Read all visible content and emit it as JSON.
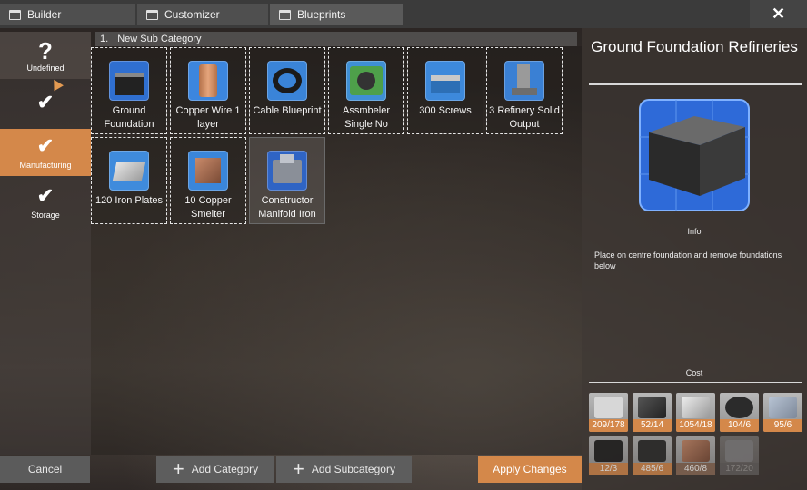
{
  "tabs": [
    {
      "label": "Builder",
      "icon": "window-icon"
    },
    {
      "label": "Customizer",
      "icon": "window-icon"
    },
    {
      "label": "Blueprints",
      "icon": "window-icon",
      "active": true
    }
  ],
  "close_glyph": "✕",
  "sidebar": {
    "items": [
      {
        "label": "Undefined",
        "glyph": "?"
      },
      {
        "label": "",
        "glyph": "✔"
      },
      {
        "label": "Manufacturing",
        "glyph": "✔",
        "selected": true
      },
      {
        "label": "Storage",
        "glyph": "✔"
      }
    ]
  },
  "subcategory": {
    "index": "1.",
    "name": "New Sub Category"
  },
  "blueprints": [
    {
      "label": "Ground Foundation",
      "icon": "foundation-icon",
      "color": "#2f6fd0"
    },
    {
      "label": "Copper Wire 1 layer",
      "icon": "copper-wire-spool-icon",
      "color": "#3c86de"
    },
    {
      "label": "Cable Blueprint",
      "icon": "cable-coil-icon",
      "color": "#3a84d8"
    },
    {
      "label": "Assmbeler Single No",
      "icon": "assembler-icon",
      "color": "#3f8fd4"
    },
    {
      "label": "300 Screws",
      "icon": "screws-icon",
      "color": "#3d89db"
    },
    {
      "label": "3 Refinery Solid Output",
      "icon": "refinery-icon",
      "color": "#3a80d4"
    },
    {
      "label": "120 Iron Plates",
      "icon": "iron-plate-icon",
      "color": "#3f8bdc"
    },
    {
      "label": "10 Copper Smelter",
      "icon": "smelter-icon",
      "color": "#3a86da"
    },
    {
      "label": "Constructor Manifold Iron",
      "icon": "constructor-icon",
      "color": "#2f64c4"
    }
  ],
  "detail": {
    "title": "Ground Foundation Refineries",
    "info_label": "Info",
    "info_text": "Place on centre foundation and remove foundations below",
    "cost_label": "Cost",
    "costs": [
      {
        "amount": "209/178",
        "icon": "concrete-icon"
      },
      {
        "amount": "52/14",
        "icon": "steel-beam-icon"
      },
      {
        "amount": "1054/18",
        "icon": "iron-plate-icon"
      },
      {
        "amount": "104/6",
        "icon": "motor-icon"
      },
      {
        "amount": "95/6",
        "icon": "metal-sheet-icon"
      },
      {
        "amount": "12/3",
        "icon": "computer-icon"
      },
      {
        "amount": "485/6",
        "icon": "frame-icon"
      },
      {
        "amount": "460/8",
        "icon": "copper-sheet-icon"
      },
      {
        "amount": "172/20",
        "icon": "glass-icon"
      }
    ]
  },
  "buttons": {
    "cancel": "Cancel",
    "add_category": "Add Category",
    "add_subcategory": "Add Subcategory",
    "apply": "Apply Changes"
  },
  "colors": {
    "accent": "#d4884a",
    "blueprint_icon_bg": "#3c7fd6"
  }
}
